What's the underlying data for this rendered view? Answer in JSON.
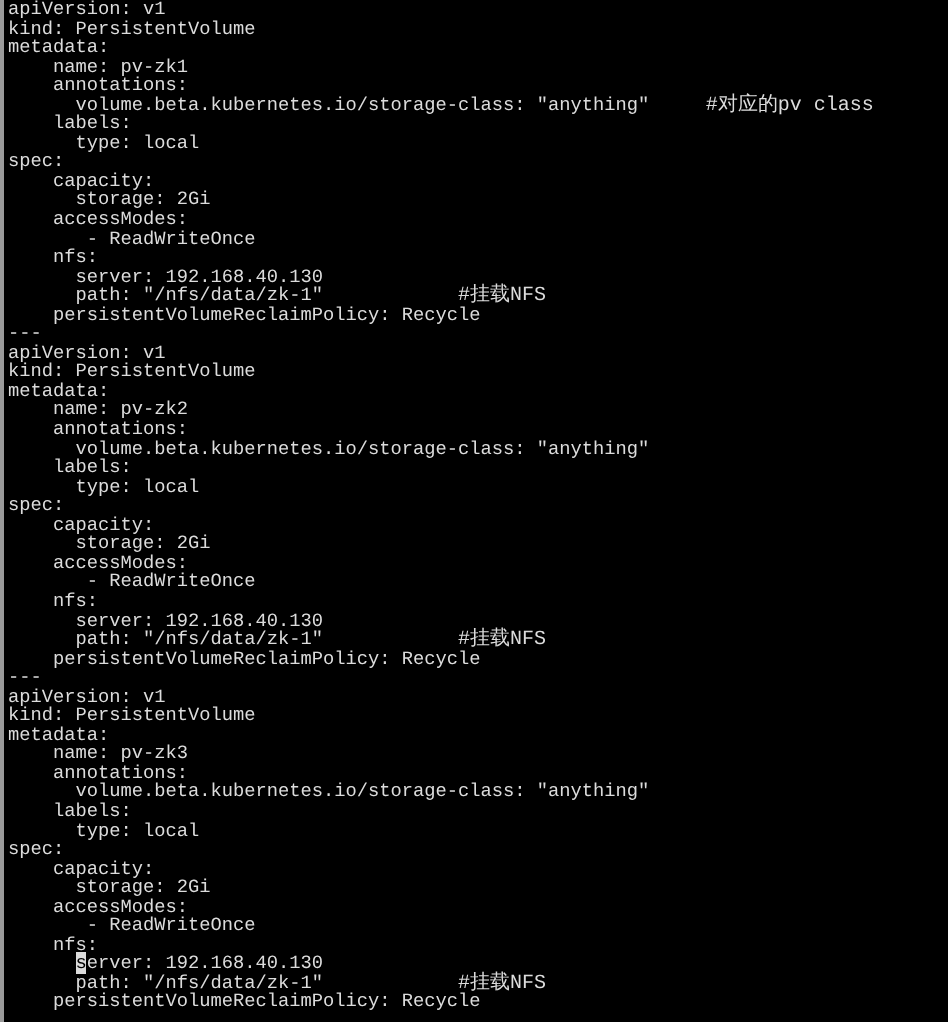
{
  "lines": [
    {
      "text": "apiVersion: v1"
    },
    {
      "text": "kind: PersistentVolume"
    },
    {
      "text": "metadata:"
    },
    {
      "text": "    name: pv-zk1"
    },
    {
      "text": "    annotations:"
    },
    {
      "text": "      volume.beta.kubernetes.io/storage-class: \"anything\"     ",
      "comment": "#对应的pv class"
    },
    {
      "text": "    labels:"
    },
    {
      "text": "      type: local"
    },
    {
      "text": "spec:"
    },
    {
      "text": "    capacity:"
    },
    {
      "text": "      storage: 2Gi"
    },
    {
      "text": "    accessModes:"
    },
    {
      "text": "       - ReadWriteOnce"
    },
    {
      "text": "    nfs:"
    },
    {
      "text": "      server: 192.168.40.130"
    },
    {
      "text": "      path: \"/nfs/data/zk-1\"            ",
      "comment": "#挂载NFS"
    },
    {
      "text": "    persistentVolumeReclaimPolicy: Recycle"
    },
    {
      "text": "---"
    },
    {
      "text": "apiVersion: v1"
    },
    {
      "text": "kind: PersistentVolume"
    },
    {
      "text": "metadata:"
    },
    {
      "text": "    name: pv-zk2"
    },
    {
      "text": "    annotations:"
    },
    {
      "text": "      volume.beta.kubernetes.io/storage-class: \"anything\""
    },
    {
      "text": "    labels:"
    },
    {
      "text": "      type: local"
    },
    {
      "text": "spec:"
    },
    {
      "text": "    capacity:"
    },
    {
      "text": "      storage: 2Gi"
    },
    {
      "text": "    accessModes:"
    },
    {
      "text": "       - ReadWriteOnce"
    },
    {
      "text": "    nfs:"
    },
    {
      "text": "      server: 192.168.40.130"
    },
    {
      "text": "      path: \"/nfs/data/zk-1\"            ",
      "comment": "#挂载NFS"
    },
    {
      "text": "    persistentVolumeReclaimPolicy: Recycle"
    },
    {
      "text": "---"
    },
    {
      "text": "apiVersion: v1"
    },
    {
      "text": "kind: PersistentVolume"
    },
    {
      "text": "metadata:"
    },
    {
      "text": "    name: pv-zk3"
    },
    {
      "text": "    annotations:"
    },
    {
      "text": "      volume.beta.kubernetes.io/storage-class: \"anything\""
    },
    {
      "text": "    labels:"
    },
    {
      "text": "      type: local"
    },
    {
      "text": "spec:"
    },
    {
      "text": "    capacity:"
    },
    {
      "text": "      storage: 2Gi"
    },
    {
      "text": "    accessModes:"
    },
    {
      "text": "       - ReadWriteOnce"
    },
    {
      "text": "    nfs:"
    },
    {
      "cursor": "s",
      "text": "erver: 192.168.40.130"
    },
    {
      "text": "      path: \"/nfs/data/zk-1\"            ",
      "comment": "#挂载NFS"
    },
    {
      "text": "    persistentVolumeReclaimPolicy: Recycle"
    }
  ]
}
